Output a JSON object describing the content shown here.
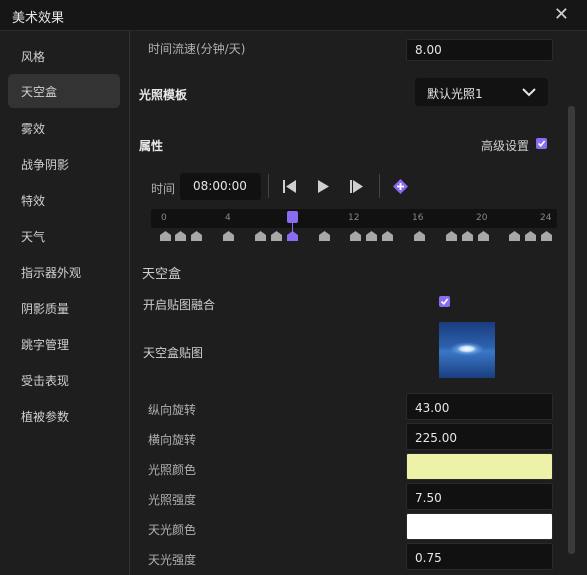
{
  "window": {
    "title": "美术效果"
  },
  "sidebar": {
    "items": [
      {
        "label": "风格"
      },
      {
        "label": "天空盒"
      },
      {
        "label": "雾效"
      },
      {
        "label": "战争阴影"
      },
      {
        "label": "特效"
      },
      {
        "label": "天气"
      },
      {
        "label": "指示器外观"
      },
      {
        "label": "阴影质量"
      },
      {
        "label": "跳字管理"
      },
      {
        "label": "受击表现"
      },
      {
        "label": "植被参数"
      }
    ],
    "active_index": 1
  },
  "time_flow": {
    "label": "时间流速(分钟/天)",
    "value": "8.00"
  },
  "light_template": {
    "label": "光照模板",
    "value": "默认光照1"
  },
  "properties": {
    "label": "属性",
    "advanced_label": "高级设置",
    "advanced_checked": true
  },
  "timeline": {
    "time_label": "时间",
    "time_value": "08:00:00",
    "tick_labels": [
      "0",
      "4",
      "8",
      "12",
      "16",
      "20",
      "24"
    ],
    "playhead_hour": 8,
    "keyframe_hours": [
      0,
      1,
      2,
      4,
      6,
      7,
      8,
      10,
      12,
      13,
      14,
      16,
      18,
      19,
      20,
      22,
      23,
      24
    ]
  },
  "skybox": {
    "section_label": "天空盒",
    "blend_label": "开启贴图融合",
    "blend_checked": true,
    "texture_label": "天空盒贴图"
  },
  "params": [
    {
      "label": "纵向旋转",
      "value": "43.00"
    },
    {
      "label": "横向旋转",
      "value": "225.00"
    },
    {
      "label": "光照颜色",
      "color": "#eef2a8"
    },
    {
      "label": "光照强度",
      "value": "7.50"
    },
    {
      "label": "天光颜色",
      "color": "#ffffff"
    },
    {
      "label": "天光强度",
      "value": "0.75"
    }
  ],
  "colors": {
    "accent": "#8a6cf0",
    "background": "#1e1e1e",
    "field": "#111111"
  }
}
